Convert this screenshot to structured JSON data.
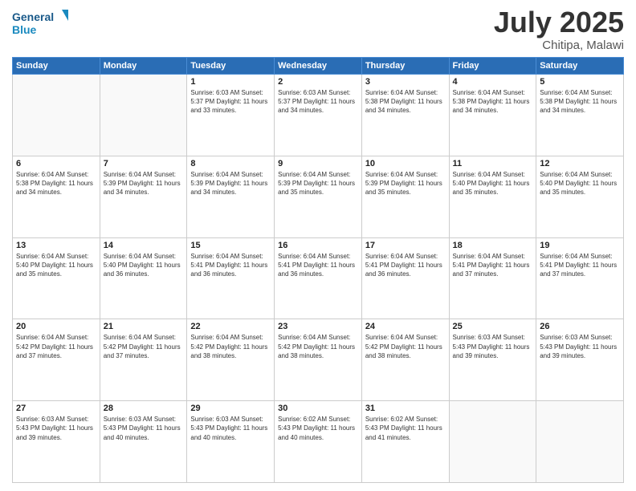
{
  "header": {
    "logo_general": "General",
    "logo_blue": "Blue",
    "month": "July 2025",
    "location": "Chitipa, Malawi"
  },
  "days_of_week": [
    "Sunday",
    "Monday",
    "Tuesday",
    "Wednesday",
    "Thursday",
    "Friday",
    "Saturday"
  ],
  "weeks": [
    [
      {
        "day": "",
        "info": ""
      },
      {
        "day": "",
        "info": ""
      },
      {
        "day": "1",
        "info": "Sunrise: 6:03 AM\nSunset: 5:37 PM\nDaylight: 11 hours and 33 minutes."
      },
      {
        "day": "2",
        "info": "Sunrise: 6:03 AM\nSunset: 5:37 PM\nDaylight: 11 hours and 34 minutes."
      },
      {
        "day": "3",
        "info": "Sunrise: 6:04 AM\nSunset: 5:38 PM\nDaylight: 11 hours and 34 minutes."
      },
      {
        "day": "4",
        "info": "Sunrise: 6:04 AM\nSunset: 5:38 PM\nDaylight: 11 hours and 34 minutes."
      },
      {
        "day": "5",
        "info": "Sunrise: 6:04 AM\nSunset: 5:38 PM\nDaylight: 11 hours and 34 minutes."
      }
    ],
    [
      {
        "day": "6",
        "info": "Sunrise: 6:04 AM\nSunset: 5:38 PM\nDaylight: 11 hours and 34 minutes."
      },
      {
        "day": "7",
        "info": "Sunrise: 6:04 AM\nSunset: 5:39 PM\nDaylight: 11 hours and 34 minutes."
      },
      {
        "day": "8",
        "info": "Sunrise: 6:04 AM\nSunset: 5:39 PM\nDaylight: 11 hours and 34 minutes."
      },
      {
        "day": "9",
        "info": "Sunrise: 6:04 AM\nSunset: 5:39 PM\nDaylight: 11 hours and 35 minutes."
      },
      {
        "day": "10",
        "info": "Sunrise: 6:04 AM\nSunset: 5:39 PM\nDaylight: 11 hours and 35 minutes."
      },
      {
        "day": "11",
        "info": "Sunrise: 6:04 AM\nSunset: 5:40 PM\nDaylight: 11 hours and 35 minutes."
      },
      {
        "day": "12",
        "info": "Sunrise: 6:04 AM\nSunset: 5:40 PM\nDaylight: 11 hours and 35 minutes."
      }
    ],
    [
      {
        "day": "13",
        "info": "Sunrise: 6:04 AM\nSunset: 5:40 PM\nDaylight: 11 hours and 35 minutes."
      },
      {
        "day": "14",
        "info": "Sunrise: 6:04 AM\nSunset: 5:40 PM\nDaylight: 11 hours and 36 minutes."
      },
      {
        "day": "15",
        "info": "Sunrise: 6:04 AM\nSunset: 5:41 PM\nDaylight: 11 hours and 36 minutes."
      },
      {
        "day": "16",
        "info": "Sunrise: 6:04 AM\nSunset: 5:41 PM\nDaylight: 11 hours and 36 minutes."
      },
      {
        "day": "17",
        "info": "Sunrise: 6:04 AM\nSunset: 5:41 PM\nDaylight: 11 hours and 36 minutes."
      },
      {
        "day": "18",
        "info": "Sunrise: 6:04 AM\nSunset: 5:41 PM\nDaylight: 11 hours and 37 minutes."
      },
      {
        "day": "19",
        "info": "Sunrise: 6:04 AM\nSunset: 5:41 PM\nDaylight: 11 hours and 37 minutes."
      }
    ],
    [
      {
        "day": "20",
        "info": "Sunrise: 6:04 AM\nSunset: 5:42 PM\nDaylight: 11 hours and 37 minutes."
      },
      {
        "day": "21",
        "info": "Sunrise: 6:04 AM\nSunset: 5:42 PM\nDaylight: 11 hours and 37 minutes."
      },
      {
        "day": "22",
        "info": "Sunrise: 6:04 AM\nSunset: 5:42 PM\nDaylight: 11 hours and 38 minutes."
      },
      {
        "day": "23",
        "info": "Sunrise: 6:04 AM\nSunset: 5:42 PM\nDaylight: 11 hours and 38 minutes."
      },
      {
        "day": "24",
        "info": "Sunrise: 6:04 AM\nSunset: 5:42 PM\nDaylight: 11 hours and 38 minutes."
      },
      {
        "day": "25",
        "info": "Sunrise: 6:03 AM\nSunset: 5:43 PM\nDaylight: 11 hours and 39 minutes."
      },
      {
        "day": "26",
        "info": "Sunrise: 6:03 AM\nSunset: 5:43 PM\nDaylight: 11 hours and 39 minutes."
      }
    ],
    [
      {
        "day": "27",
        "info": "Sunrise: 6:03 AM\nSunset: 5:43 PM\nDaylight: 11 hours and 39 minutes."
      },
      {
        "day": "28",
        "info": "Sunrise: 6:03 AM\nSunset: 5:43 PM\nDaylight: 11 hours and 40 minutes."
      },
      {
        "day": "29",
        "info": "Sunrise: 6:03 AM\nSunset: 5:43 PM\nDaylight: 11 hours and 40 minutes."
      },
      {
        "day": "30",
        "info": "Sunrise: 6:02 AM\nSunset: 5:43 PM\nDaylight: 11 hours and 40 minutes."
      },
      {
        "day": "31",
        "info": "Sunrise: 6:02 AM\nSunset: 5:43 PM\nDaylight: 11 hours and 41 minutes."
      },
      {
        "day": "",
        "info": ""
      },
      {
        "day": "",
        "info": ""
      }
    ]
  ]
}
